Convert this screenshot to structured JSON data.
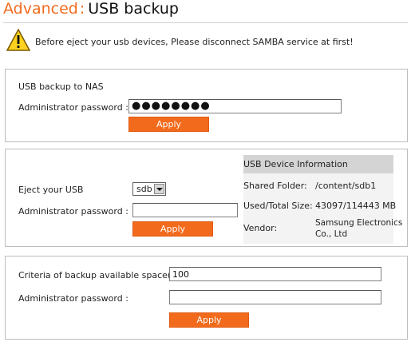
{
  "header": {
    "section": "Advanced",
    "separator": ":",
    "title": "USB backup"
  },
  "warning": {
    "icon": "warning-icon",
    "text": "Before eject your usb devices, Please disconnect SAMBA service at first!"
  },
  "backup_to_nas": {
    "heading": "USB backup to NAS",
    "password_label": "Administrator password :",
    "password_value": "●●●●●●●●",
    "apply_label": "Apply"
  },
  "eject": {
    "eject_label": "Eject your USB",
    "device_selected": "sdb",
    "password_label": "Administrator password :",
    "password_value": "",
    "apply_label": "Apply",
    "info": {
      "heading": "USB Device Information",
      "shared_folder_label": "Shared Folder:",
      "shared_folder_value": "/content/sdb1",
      "used_total_label": "Used/Total Size:",
      "used_total_value": "43097/114443 MB",
      "vendor_label": "Vendor:",
      "vendor_value_line1": "Samsung Electronics",
      "vendor_value_line2": "Co., Ltd"
    }
  },
  "criteria": {
    "criteria_label": "Criteria of backup available space(%) :",
    "criteria_value": "100",
    "password_label": "Administrator password :",
    "password_value": "",
    "apply_label": "Apply"
  },
  "colors": {
    "accent": "#f26b1d",
    "info_head_bg": "#d4d4d4",
    "info_bg": "#f3f3f3"
  }
}
